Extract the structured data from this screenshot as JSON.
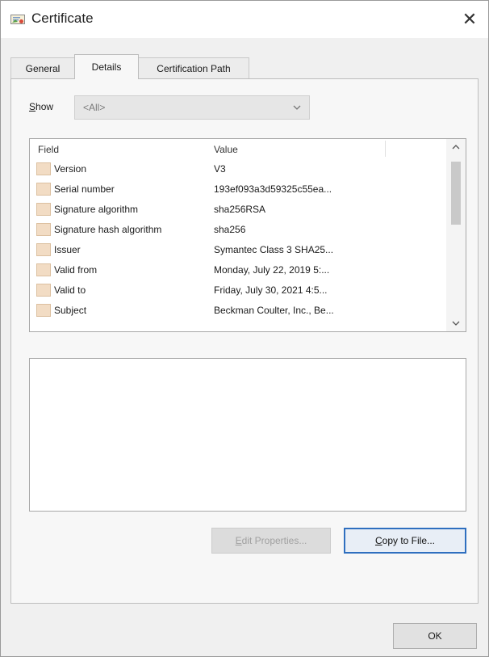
{
  "window": {
    "title": "Certificate",
    "close_glyph": "✕",
    "icon": "certificate-icon"
  },
  "tabs": [
    {
      "label": "General",
      "active": false
    },
    {
      "label": "Details",
      "active": true
    },
    {
      "label": "Certification Path",
      "active": false
    }
  ],
  "show": {
    "label_access": "S",
    "label_rest": "how",
    "selected": "<All>"
  },
  "list": {
    "headers": {
      "field": "Field",
      "value": "Value"
    },
    "rows": [
      {
        "field": "Version",
        "value": "V3"
      },
      {
        "field": "Serial number",
        "value": "193ef093a3d59325c55ea..."
      },
      {
        "field": "Signature algorithm",
        "value": "sha256RSA"
      },
      {
        "field": "Signature hash algorithm",
        "value": "sha256"
      },
      {
        "field": "Issuer",
        "value": "Symantec Class 3 SHA25..."
      },
      {
        "field": "Valid from",
        "value": "Monday, July 22, 2019 5:..."
      },
      {
        "field": "Valid to",
        "value": "Friday, July 30, 2021 4:5..."
      },
      {
        "field": "Subject",
        "value": "Beckman Coulter, Inc., Be..."
      }
    ],
    "row_icon": "certificate-field-icon"
  },
  "buttons": {
    "edit_properties": {
      "access": "E",
      "rest": "dit Properties...",
      "enabled": false
    },
    "copy_to_file": {
      "access": "C",
      "rest": "opy to File...",
      "enabled": true
    },
    "ok": "OK"
  },
  "colors": {
    "accent_border": "#2f6fbf",
    "field_icon_fill": "#f2dcc4"
  }
}
